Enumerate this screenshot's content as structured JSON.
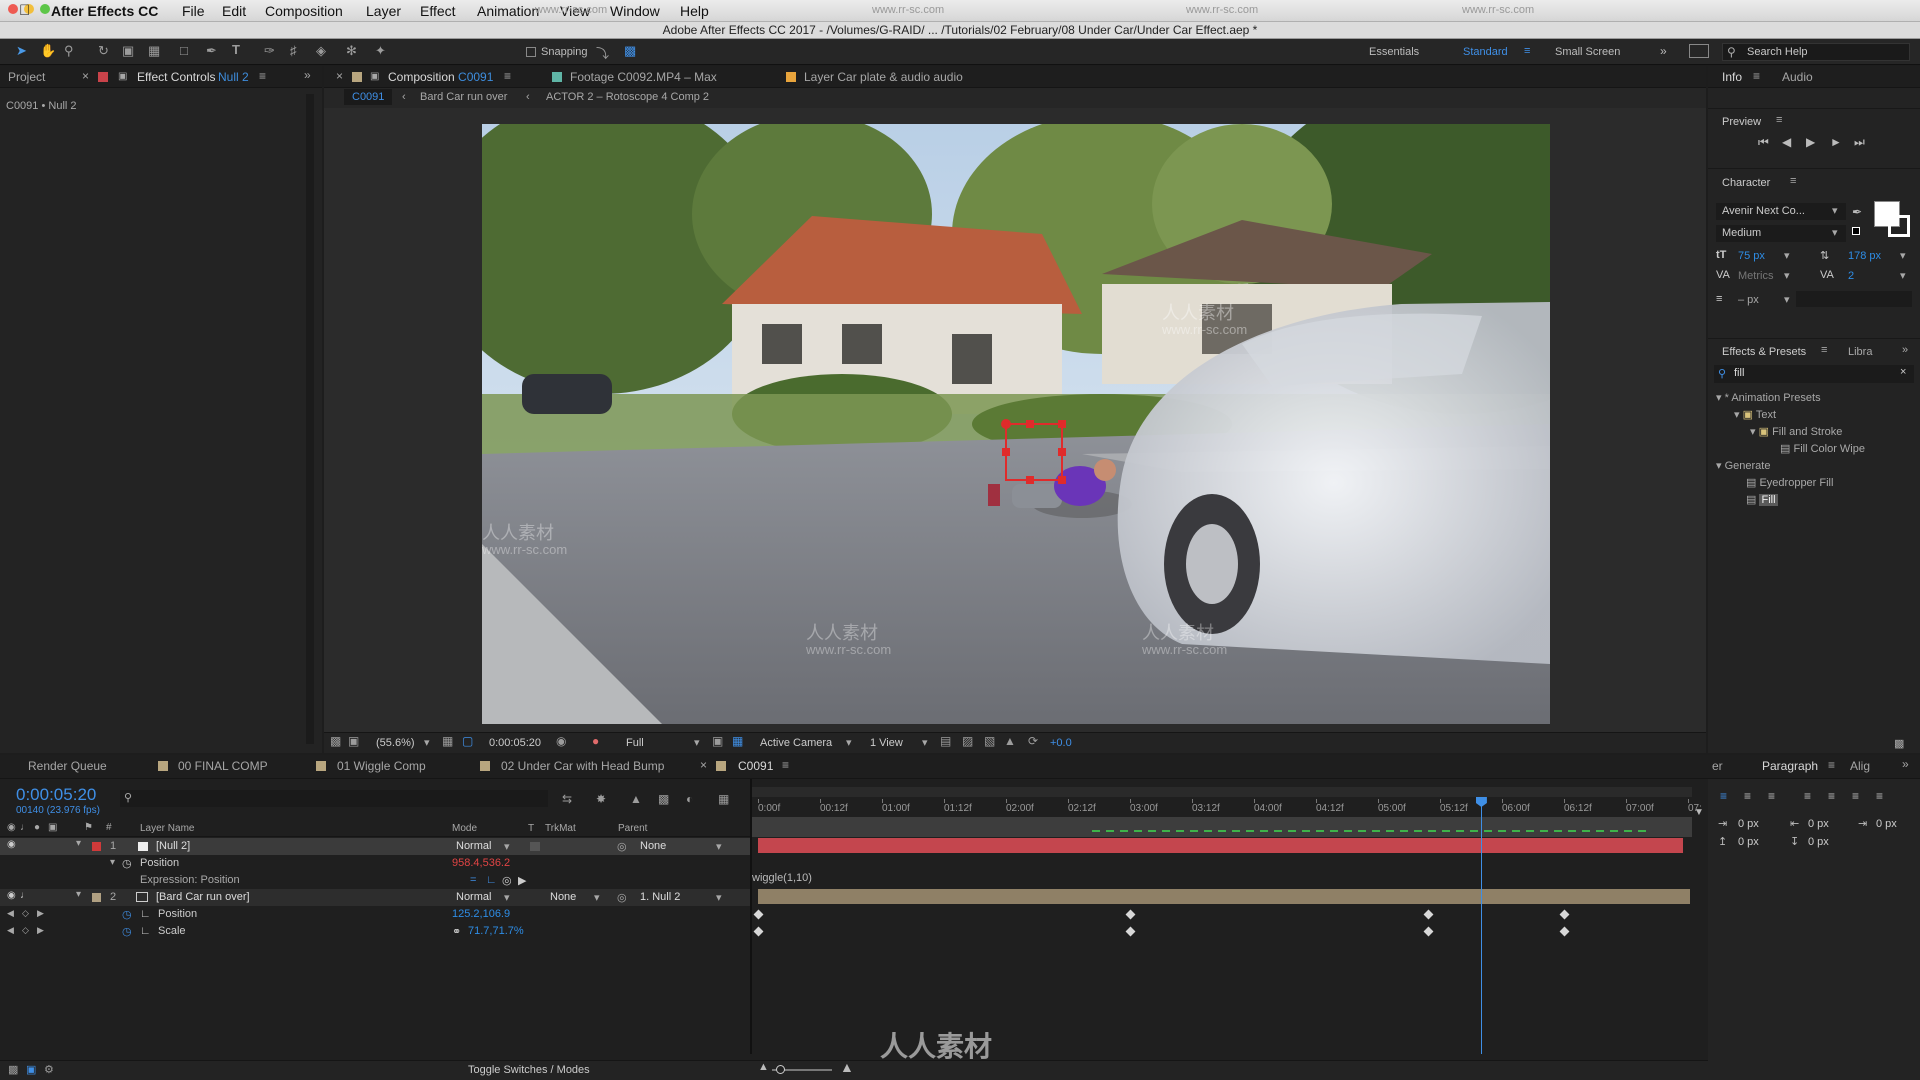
{
  "menubar": {
    "app_name": "After Effects CC",
    "items": [
      "File",
      "Edit",
      "Composition",
      "Layer",
      "Effect",
      "Animation",
      "View",
      "Window",
      "Help"
    ],
    "watermarks": [
      "www.rr-sc.com",
      "www.rr-sc.com",
      "www.rr-sc.com",
      "www.rr-sc.com",
      "www.rr-sc.com"
    ]
  },
  "window": {
    "title": "Adobe After Effects CC 2017 - /Volumes/G-RAID/ ... /Tutorials/02 February/08 Under Car/Under Car Effect.aep *"
  },
  "toolbar": {
    "snapping_label": "Snapping",
    "workspaces": [
      "Essentials",
      "Standard",
      "Small Screen"
    ],
    "active_workspace": "Standard",
    "search_placeholder": "Search Help"
  },
  "project_panel": {
    "tabs": [
      "Project",
      "Effect Controls"
    ],
    "effect_controls_target": "Null 2",
    "breadcrumb": "C0091 • Null 2"
  },
  "viewer": {
    "tabs": [
      {
        "prefix": "Composition",
        "name": "C0091"
      },
      {
        "prefix": "Footage",
        "name": "C0092.MP4 – Max"
      },
      {
        "prefix": "Layer",
        "name": "Car plate & audio audio"
      }
    ],
    "breadcrumbs": [
      "C0091",
      "Bard Car run over",
      "ACTOR 2 – Rotoscope 4 Comp 2"
    ],
    "zoom": "(55.6%)",
    "timecode": "0:00:05:20",
    "resolution": "Full",
    "camera": "Active Camera",
    "views": "1 View",
    "exposure": "+0.0",
    "watermark_cn": "人人素材",
    "watermark_url": "www.rr-sc.com"
  },
  "right_panels": {
    "info_tabs": [
      "Info",
      "Audio"
    ],
    "preview_title": "Preview",
    "character_title": "Character",
    "font_family": "Avenir Next Co...",
    "font_style": "Medium",
    "font_size": "75 px",
    "leading": "178 px",
    "kerning": "Metrics",
    "tracking": "2",
    "stroke_width": "– px",
    "effects_tabs": [
      "Effects & Presets",
      "Libra"
    ],
    "effects_search": "fill",
    "tree": [
      {
        "label": "* Animation Presets",
        "level": 0,
        "kind": "folder-open"
      },
      {
        "label": "Text",
        "level": 1,
        "kind": "folder-open"
      },
      {
        "label": "Fill and Stroke",
        "level": 2,
        "kind": "folder-open"
      },
      {
        "label": "Fill Color Wipe",
        "level": 3,
        "kind": "preset"
      },
      {
        "label": "Generate",
        "level": 0,
        "kind": "folder-open"
      },
      {
        "label": "Eyedropper Fill",
        "level": 1,
        "kind": "effect"
      },
      {
        "label": "Fill",
        "level": 1,
        "kind": "effect-selected"
      }
    ],
    "paragraph_tabs": [
      "er",
      "Paragraph",
      "Alig"
    ],
    "indent_values": [
      "0 px",
      "0 px",
      "0 px",
      "0 px",
      "0 px"
    ]
  },
  "timeline": {
    "tabs": [
      "Render Queue",
      "00 FINAL COMP",
      "01 Wiggle Comp",
      "02 Under Car with Head Bump",
      "C0091"
    ],
    "active_tab": "C0091",
    "current_time": "0:00:05:20",
    "frame_info": "00140 (23.976 fps)",
    "search_placeholder": "",
    "columns": {
      "layer_name": "Layer Name",
      "mode": "Mode",
      "t": "T",
      "trkmat": "TrkMat",
      "parent": "Parent"
    },
    "ruler_labels": [
      "0:00f",
      "00:12f",
      "01:00f",
      "01:12f",
      "02:00f",
      "02:12f",
      "03:00f",
      "03:12f",
      "04:00f",
      "04:12f",
      "05:00f",
      "05:12f",
      "06:00f",
      "06:12f",
      "07:00f",
      "07:"
    ],
    "playhead_time_seconds": 5.83,
    "comp_duration_seconds": 7.5,
    "layers": [
      {
        "num": "1",
        "name": "[Null 2]",
        "mode": "Normal",
        "trkmat": "",
        "parent": "None",
        "color": "#d03a3a"
      },
      {
        "num": "2",
        "name": "[Bard Car run over]",
        "mode": "Normal",
        "trkmat": "None",
        "parent": "1. Null 2",
        "color": "#b0a082"
      }
    ],
    "layer1_position_label": "Position",
    "layer1_position_value": "958.4,536.2",
    "expression_label": "Expression: Position",
    "expression_text": "wiggle(1,10)",
    "layer2_position_label": "Position",
    "layer2_position_value": "125.2,106.9",
    "layer2_scale_label": "Scale",
    "layer2_scale_value": "71.7,71.7%",
    "keyframe_times_seconds": [
      0,
      3.0,
      5.4,
      6.5
    ],
    "toggle_label": "Toggle Switches / Modes",
    "bottom_watermark": "人人素材"
  },
  "colors": {
    "accent_blue": "#2e8de6",
    "null_bar": "#c4464e",
    "footage_bar": "#8f8066",
    "work_area": "#5c5c5c",
    "playhead": "#3f8fe6",
    "keyframe": "#dcdcdc"
  }
}
